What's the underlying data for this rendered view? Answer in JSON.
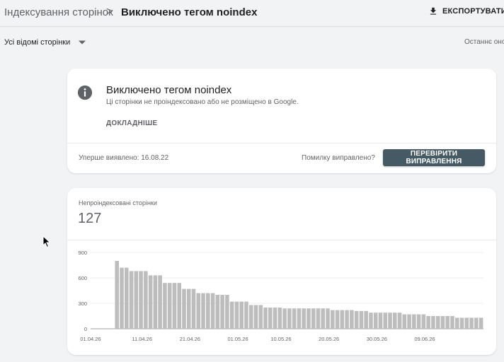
{
  "header": {
    "breadcrumb_parent": "Індексування сторінок",
    "separator": ">",
    "breadcrumb_current": "Виключено тегом noindex",
    "export_label": "ЕКСПОРТУВАТИ"
  },
  "filter": {
    "selected": "Усі відомі сторінки",
    "last_updated": "Останнє оно"
  },
  "issue_card": {
    "title": "Виключено тегом noindex",
    "subtitle": "Ці сторінки не проіндексовано або не розміщено в Google.",
    "more_label": "ДОКЛАДНІШЕ",
    "first_detected": "Уперше виявлено: 16.08.22",
    "fixed_question": "Помилку виправлено?",
    "validate_button": "ПЕРЕВІРИТИ ВИПРАВЛЕННЯ"
  },
  "chart_card": {
    "label": "Непроіндексовані сторінки",
    "count": "127"
  },
  "colors": {
    "bar": "#bdbdbd",
    "button_bg": "#455a64",
    "page_bg": "#f1f3f4"
  },
  "chart_data": {
    "type": "bar",
    "title": "",
    "xlabel": "",
    "ylabel": "",
    "ylim": [
      0,
      900
    ],
    "yticks": [
      0,
      300,
      600,
      900
    ],
    "xtick_labels": [
      "01.04.26",
      "11.04.26",
      "21.04.26",
      "01.05.26",
      "10.05.26",
      "20.05.26",
      "30.05.26",
      "09.06.26"
    ],
    "xtick_indices": [
      0,
      10,
      20,
      30,
      39,
      49,
      59,
      69
    ],
    "grid": true,
    "categories": [
      "01.04",
      "02.04",
      "03.04",
      "04.04",
      "05.04",
      "06.04",
      "07.04",
      "08.04",
      "09.04",
      "10.04",
      "11.04",
      "12.04",
      "13.04",
      "14.04",
      "15.04",
      "16.04",
      "17.04",
      "18.04",
      "19.04",
      "20.04",
      "21.04",
      "22.04",
      "23.04",
      "24.04",
      "25.04",
      "26.04",
      "27.04",
      "28.04",
      "29.04",
      "30.04",
      "01.05",
      "02.05",
      "03.05",
      "04.05",
      "05.05",
      "06.05",
      "07.05",
      "08.05",
      "09.05",
      "10.05",
      "11.05",
      "12.05",
      "13.05",
      "14.05",
      "15.05",
      "16.05",
      "17.05",
      "18.05",
      "19.05",
      "20.05",
      "21.05",
      "22.05",
      "23.05",
      "24.05",
      "25.05",
      "26.05",
      "27.05",
      "28.05",
      "29.05",
      "30.05",
      "31.05",
      "01.06",
      "02.06",
      "03.06",
      "04.06",
      "05.06",
      "06.06",
      "07.06",
      "08.06",
      "09.06",
      "10.06",
      "11.06",
      "12.06",
      "13.06",
      "14.06",
      "15.06"
    ],
    "values": [
      null,
      null,
      null,
      null,
      null,
      800,
      720,
      720,
      680,
      680,
      680,
      680,
      630,
      630,
      630,
      540,
      540,
      540,
      540,
      470,
      470,
      470,
      420,
      420,
      420,
      420,
      400,
      400,
      400,
      320,
      320,
      320,
      320,
      280,
      280,
      280,
      250,
      250,
      250,
      250,
      240,
      240,
      240,
      240,
      240,
      240,
      240,
      240,
      240,
      240,
      220,
      220,
      220,
      220,
      220,
      210,
      210,
      210,
      190,
      190,
      190,
      190,
      190,
      190,
      190,
      170,
      170,
      170,
      170,
      170,
      150,
      150,
      150,
      150,
      150,
      150,
      130,
      130,
      130,
      130,
      130,
      130
    ]
  }
}
